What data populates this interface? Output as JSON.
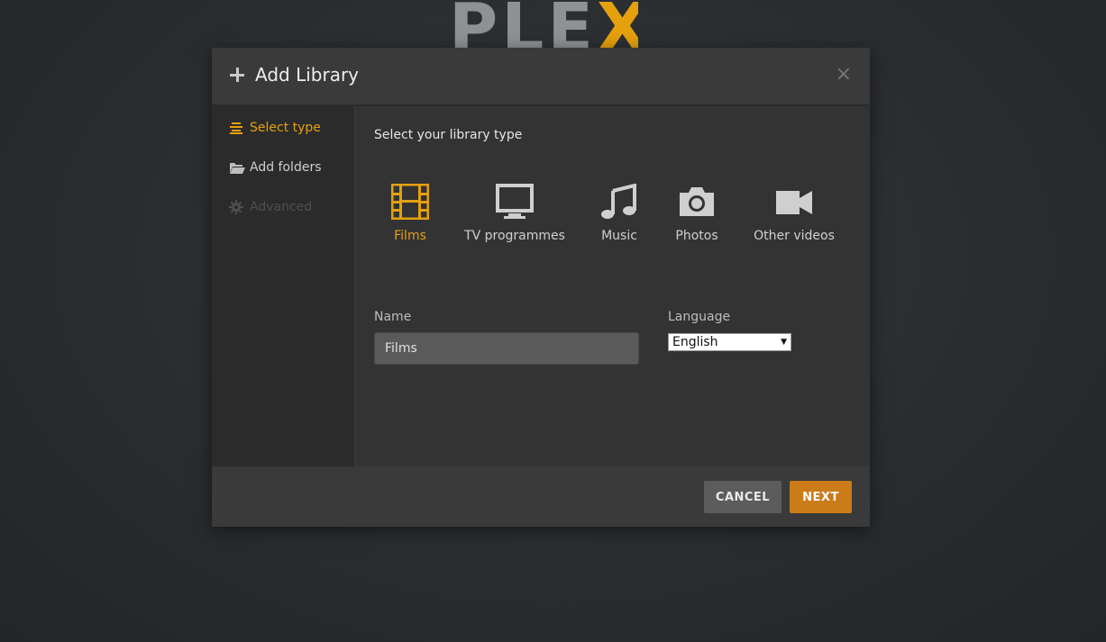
{
  "app": {
    "logo_text_left": "PLE",
    "logo_text_right": "X",
    "brand_color": "#e5a00d"
  },
  "modal": {
    "title": "Add Library",
    "close_symbol": "×"
  },
  "sidebar": {
    "items": [
      {
        "label": "Select type",
        "icon": "list-icon",
        "state": "active"
      },
      {
        "label": "Add folders",
        "icon": "folder-icon",
        "state": "normal"
      },
      {
        "label": "Advanced",
        "icon": "gear-icon",
        "state": "disabled"
      }
    ]
  },
  "content": {
    "prompt": "Select your library type",
    "types": [
      {
        "label": "Films",
        "icon": "film-icon",
        "selected": true
      },
      {
        "label": "TV programmes",
        "icon": "tv-icon",
        "selected": false
      },
      {
        "label": "Music",
        "icon": "music-icon",
        "selected": false
      },
      {
        "label": "Photos",
        "icon": "camera-icon",
        "selected": false
      },
      {
        "label": "Other videos",
        "icon": "video-camera-icon",
        "selected": false
      }
    ],
    "name_label": "Name",
    "name_value": "Films",
    "language_label": "Language",
    "language_value": "English"
  },
  "footer": {
    "cancel_label": "CANCEL",
    "next_label": "NEXT"
  }
}
